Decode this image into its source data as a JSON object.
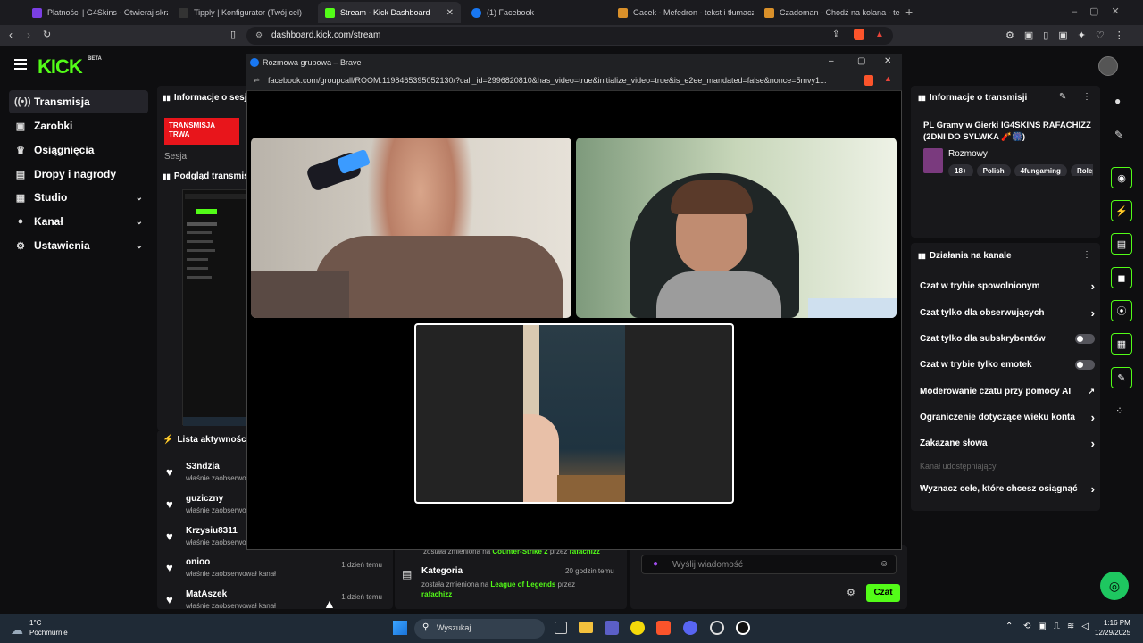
{
  "browser": {
    "tabs": [
      {
        "label": "Płatności | G4Skins - Otwieraj skrzynki"
      },
      {
        "label": "Tipply | Konfigurator (Twój cel)"
      },
      {
        "label": "Stream - Kick Dashboard"
      },
      {
        "label": "(1) Facebook"
      },
      {
        "label": "Gacek - Mefedron - tekst i tłumaczenie"
      },
      {
        "label": "Czadoman - Chodź na kolana - tekst"
      }
    ],
    "url": "dashboard.kick.com/stream"
  },
  "kick": {
    "logo": "KICK",
    "logo_badge": "BETA",
    "nav": [
      {
        "label": "Transmisja",
        "icon": "broadcast-icon"
      },
      {
        "label": "Zarobki",
        "icon": "wallet-icon"
      },
      {
        "label": "Osiągnięcia",
        "icon": "trophy-icon"
      },
      {
        "label": "Dropy i nagrody",
        "icon": "gift-icon"
      },
      {
        "label": "Studio",
        "icon": "studio-icon"
      },
      {
        "label": "Kanał",
        "icon": "user-icon"
      },
      {
        "label": "Ustawienia",
        "icon": "gear-icon"
      }
    ],
    "session_info_title": "Informacje o sesji",
    "live_badge": "TRANSMISJA TRWA",
    "session_label": "Sesja",
    "preview_title": "Podgląd transmisji",
    "activity_title": "Lista aktywności",
    "activity": [
      {
        "name": "S3ndzia",
        "status": "właśnie zaobserwował kanał",
        "time": ""
      },
      {
        "name": "guziczny",
        "status": "właśnie zaobserwował kanał",
        "time": ""
      },
      {
        "name": "Krzysiu8311",
        "status": "właśnie zaobserwował kanał",
        "time": ""
      },
      {
        "name": "onioo",
        "status": "właśnie zaobserwował kanał",
        "time": "1 dzień temu"
      },
      {
        "name": "MatAszek",
        "status": "właśnie zaobserwował kanał",
        "time": "1 dzień temu"
      }
    ],
    "category_event": {
      "prev_line_a": "została zmieniona na",
      "prev_category": "Counter-Strike 2",
      "prev_line_b": "przez",
      "prev_user": "rafachizz",
      "title": "Kategoria",
      "time": "20 godzin temu",
      "line_a": "została zmieniona na",
      "category": "League of Legends",
      "line_b": "przez",
      "user": "rafachizz"
    },
    "chat": {
      "placeholder": "Wyślij wiadomość",
      "send": "Czat"
    },
    "stream_info": {
      "header": "Informacje o transmisji",
      "title": "PL Gramy w Gierki IG4SKINS RAFACHIZZ (2DNI DO SYLWKA 🧨🎆)",
      "category": "Rozmowy",
      "tags": [
        "18+",
        "Polish",
        "4fungaming",
        "Rolepl"
      ]
    },
    "channel_actions": {
      "header": "Działania na kanale",
      "items": [
        {
          "label": "Czat w trybie spowolnionym",
          "type": "arrow"
        },
        {
          "label": "Czat tylko dla obserwujących",
          "type": "arrow"
        },
        {
          "label": "Czat tylko dla subskrybentów",
          "type": "toggle"
        },
        {
          "label": "Czat w trybie tylko emotek",
          "type": "toggle"
        },
        {
          "label": "Moderowanie czatu przy pomocy AI",
          "type": "external"
        },
        {
          "label": "Ograniczenie dotyczące wieku konta",
          "type": "arrow"
        },
        {
          "label": "Zakazane słowa",
          "type": "arrow"
        },
        {
          "label": "Kanał udostępniający",
          "type": "disabled"
        },
        {
          "label": "Wyznacz cele, które chcesz osiągnąć",
          "type": "arrow"
        }
      ]
    }
  },
  "popup": {
    "title": "Rozmowa grupowa – Brave",
    "url": "facebook.com/groupcall/ROOM:1198465395052130/?call_id=2996820810&has_video=true&initialize_video=true&is_e2ee_mandated=false&nonce=5mvy1..."
  },
  "taskbar": {
    "weather_temp": "1°C",
    "weather_desc": "Pochmurnie",
    "search": "Wyszukaj",
    "time": "1:16 PM",
    "date": "12/29/2025"
  },
  "colors": {
    "kick_green": "#53fc18",
    "live_red": "#e8151b"
  }
}
